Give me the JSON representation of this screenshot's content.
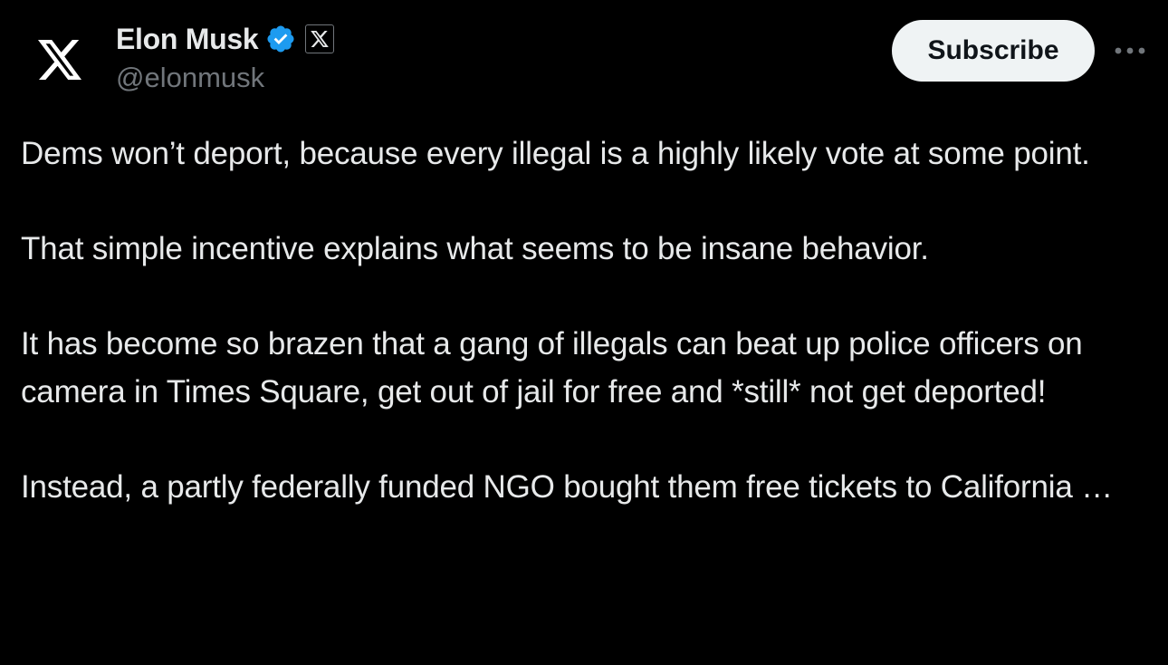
{
  "author": {
    "display_name": "Elon Musk",
    "handle": "@elonmusk",
    "avatar_icon": "x-logo-icon",
    "verified_badge_icon": "verified-badge-icon",
    "affiliate_badge_icon": "x-affiliate-badge-icon"
  },
  "actions": {
    "subscribe_label": "Subscribe",
    "more_icon": "more-options-icon"
  },
  "tweet": {
    "paragraphs": [
      "Dems won’t deport, because every illegal is a highly likely vote at some point.",
      "That simple incentive explains what seems to be insane behavior.",
      "It has become so brazen that a gang of illegals can beat up police officers on camera in Times Square, get out of jail for free and *still* not get deported!",
      "Instead, a partly federally funded NGO bought them free tickets to California …"
    ]
  },
  "colors": {
    "background": "#000000",
    "text_primary": "#e7e9ea",
    "text_secondary": "#71767b",
    "verified_blue": "#1d9bf0",
    "subscribe_bg": "#eff3f4",
    "subscribe_text": "#0f1419"
  }
}
